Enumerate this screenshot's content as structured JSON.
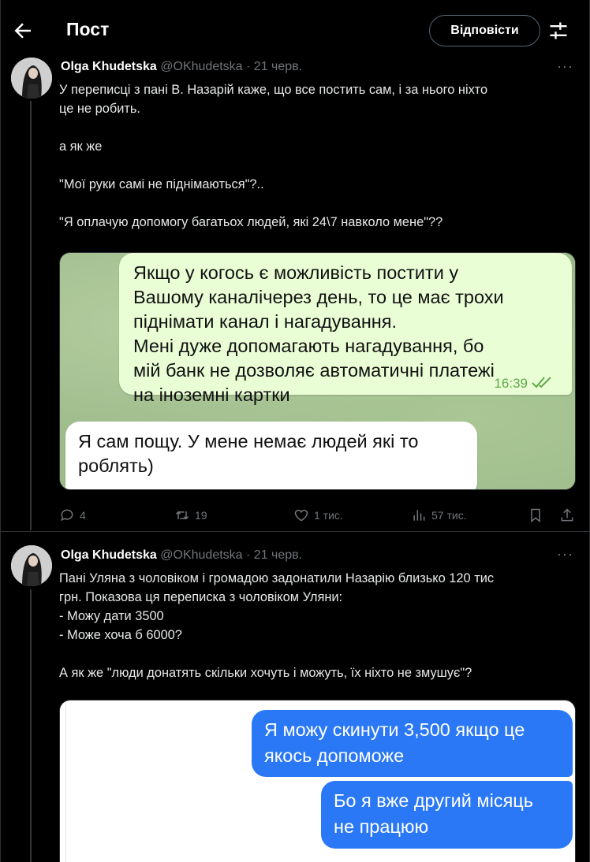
{
  "header": {
    "title": "Пост",
    "reply_label": "Відповісти"
  },
  "tweets": [
    {
      "name": "Olga Khudetska",
      "handle": "@OKhudetska",
      "date": "· 21 черв.",
      "more": "···",
      "lines": [
        "У переписці з пані В. Назарій каже, що все постить сам, і за нього ніхто",
        "це не робить.",
        "",
        "а як же",
        "",
        "\"Мої руки самі не піднімаються\"?..",
        "",
        "\"Я оплачую допомогу багатьох людей, які 24\\7 навколо мене\"??"
      ],
      "media": {
        "outgoing": [
          "Якщо у когось є можливість постити у",
          "Вашому каналічерез день, то це має трохи",
          "піднімати канал і нагадування.",
          "Мені дуже допомагають нагадування,  бо",
          "мій банк не дозволяє автоматичні платежі",
          "на іноземні картки"
        ],
        "time": "16:39",
        "incoming": [
          "Я сам пощу. У мене немає людей які то",
          "роблять)"
        ]
      },
      "actions": {
        "replies": "4",
        "reposts": "19",
        "likes": "1 тис.",
        "views": "57 тис."
      }
    },
    {
      "name": "Olga Khudetska",
      "handle": "@OKhudetska",
      "date": "· 21 черв.",
      "more": "···",
      "lines": [
        "Пані Уляна з чоловіком і громадою задонатили Назарію близько 120 тис",
        "грн. Показова ця переписка з чоловіком Уляни:",
        "- Можу дати 3500",
        "- Може хоча б 6000?",
        "",
        "А як же \"люди донатять скільки хочуть і можуть, їх ніхто не змушує\"?"
      ],
      "media": {
        "msg1": [
          "Я можу скинути 3,500 якщо це",
          "якось допоможе"
        ],
        "msg2": [
          "Бо я вже другий місяць",
          "не працюю"
        ]
      }
    }
  ]
}
